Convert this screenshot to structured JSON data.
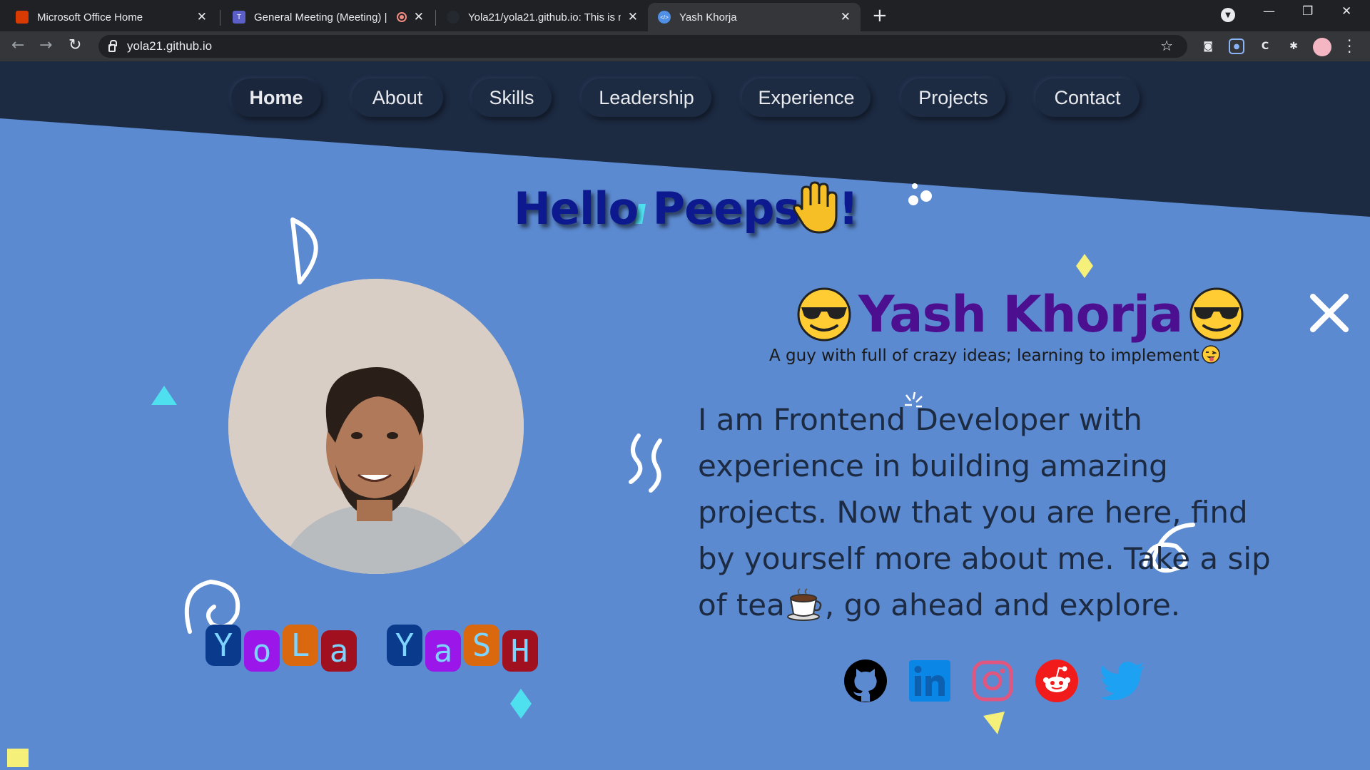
{
  "browser": {
    "tabs": [
      {
        "title": "Microsoft Office Home",
        "favicon": "office-icon",
        "color": "#d83b01"
      },
      {
        "title": "General Meeting (Meeting) |",
        "favicon": "teams-icon",
        "color": "#5b5fc7"
      },
      {
        "title": "Yola21/yola21.github.io: This is m",
        "favicon": "github-icon",
        "color": "#24292f"
      },
      {
        "title": "Yash Khorja",
        "favicon": "code-icon",
        "color": "#4f8fe6"
      }
    ],
    "new_tab": "+",
    "url": "yola21.github.io",
    "win_minimize": "—",
    "win_restore": "❐",
    "win_close": "✕"
  },
  "nav": {
    "items": [
      {
        "label": "Home"
      },
      {
        "label": "About"
      },
      {
        "label": "Skills"
      },
      {
        "label": "Leadership"
      },
      {
        "label": "Experience"
      },
      {
        "label": "Projects"
      },
      {
        "label": "Contact"
      }
    ],
    "active": "Home"
  },
  "hero": {
    "greeting": "Hello Peeps!!!",
    "name": "Yash Khorja",
    "tagline": "A guy with full of crazy ideas; learning to implement",
    "bio_part1": "I am Frontend Developer with experience in building amazing projects. Now that you are here, find by yourself more about me. Take a sip of tea",
    "bio_part2": ", go ahead and explore."
  },
  "logo": {
    "word1": [
      "Y",
      "o",
      "L",
      "a"
    ],
    "word2": [
      "Y",
      "a",
      "S",
      "H"
    ],
    "tile_colors": [
      "#0a3a8c",
      "#9b16e8",
      "#d9680f",
      "#a0101e"
    ]
  },
  "socials": [
    {
      "name": "GitHub",
      "icon": "github-icon",
      "color": "#000000"
    },
    {
      "name": "LinkedIn",
      "icon": "linkedin-icon",
      "color": "#0a86e6"
    },
    {
      "name": "Instagram",
      "icon": "instagram-icon",
      "color": "#e0567e"
    },
    {
      "name": "Reddit",
      "icon": "reddit-icon",
      "color": "#f21b1b"
    },
    {
      "name": "Twitter",
      "icon": "twitter-icon",
      "color": "#1da1f2"
    }
  ],
  "colors": {
    "page_bg": "#5c8ad1",
    "header_bg": "#1c2a42",
    "name": "#4b0f8f",
    "greeting": "#0d1a8f"
  }
}
